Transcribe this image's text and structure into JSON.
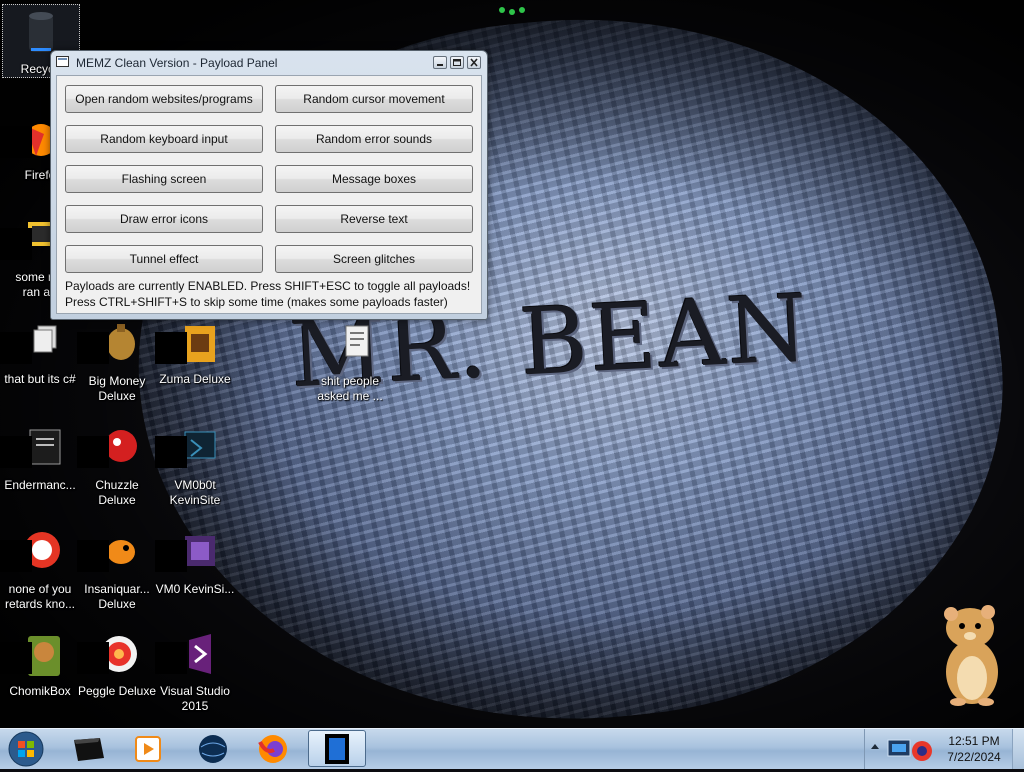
{
  "wallpaper": {
    "title_text": "MR. BEAN"
  },
  "desktop_icons": [
    {
      "label": "Recycle",
      "icon": "recycle-bin-icon"
    },
    {
      "label": "Firefo",
      "icon": "firefox-icon"
    },
    {
      "label": "some rus\nran a r",
      "icon": "folder-icon"
    },
    {
      "label": "that but its c#",
      "icon": "files-icon"
    },
    {
      "label": "Endermanc...",
      "icon": "app-window-icon"
    },
    {
      "label": "none of you retards kno...",
      "icon": "game-icon"
    },
    {
      "label": "ChomikBox",
      "icon": "chomikbox-icon"
    },
    {
      "label": "Big Money Deluxe",
      "icon": "money-bag-icon"
    },
    {
      "label": "Chuzzle Deluxe",
      "icon": "chuzzle-icon"
    },
    {
      "label": "Insaniquar... Deluxe",
      "icon": "fish-icon"
    },
    {
      "label": "Peggle Deluxe",
      "icon": "peggle-icon"
    },
    {
      "label": "Zuma Deluxe",
      "icon": "zuma-icon"
    },
    {
      "label": "VM0b0t KevinSite",
      "icon": "vm-icon"
    },
    {
      "label": "VM0 KevinSi...",
      "icon": "vm-icon"
    },
    {
      "label": "Visual Studio 2015",
      "icon": "visual-studio-icon"
    },
    {
      "label": "shit people asked me ...",
      "icon": "document-icon"
    }
  ],
  "memz": {
    "title": "MEMZ Clean Version - Payload Panel",
    "buttons": [
      "Open random websites/programs",
      "Random cursor movement",
      "Random keyboard input",
      "Random error sounds",
      "Flashing screen",
      "Message boxes",
      "Draw error icons",
      "Reverse text",
      "Tunnel effect",
      "Screen glitches"
    ],
    "status_line1": "Payloads are currently ENABLED. Press SHIFT+ESC to toggle all payloads!",
    "status_line2": "Press CTRL+SHIFT+S to skip some time (makes some payloads faster)"
  },
  "taskbar": {
    "items": [
      "start-orb-icon",
      "window-switcher-icon",
      "media-player-icon",
      "globe-icon",
      "firefox-icon",
      "memz-app-icon"
    ],
    "clock_time": "12:51 PM",
    "clock_date": "7/22/2024"
  },
  "colors": {
    "taskbar": "#a8c2de",
    "window_client": "#f0f0f0",
    "button_border": "#707070"
  }
}
